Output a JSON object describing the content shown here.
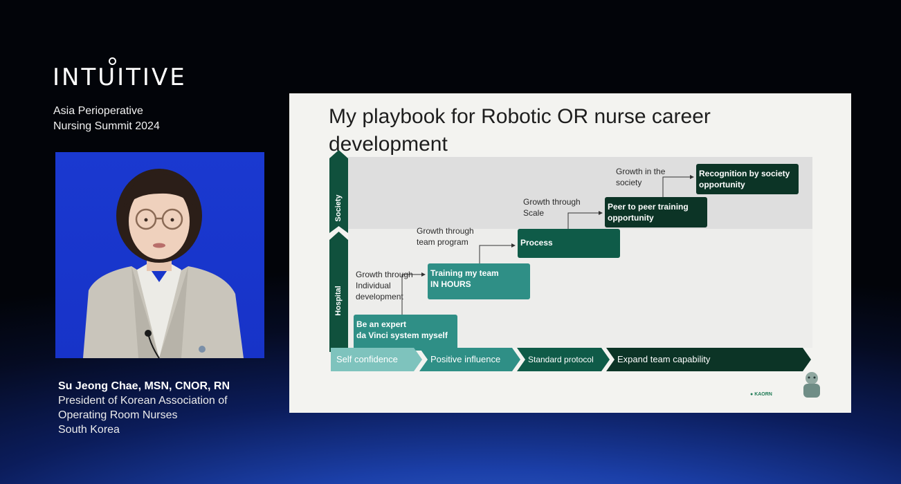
{
  "brand": {
    "logo_text": "INTUITIVE",
    "event_line1": "Asia Perioperative",
    "event_line2": "Nursing Summit 2024"
  },
  "speaker": {
    "name": "Su Jeong Chae, MSN, CNOR, RN",
    "title_line1": "President of Korean Association of",
    "title_line2": "Operating Room Nurses",
    "country": "South Korea"
  },
  "slide": {
    "title_line1": "My playbook for Robotic OR nurse career",
    "title_line2": "development",
    "vertical_labels": {
      "society": "Society",
      "hospital": "Hospital"
    },
    "steps": [
      {
        "box": "Be an expert\nda Vinci system myself",
        "connector_label": ""
      },
      {
        "box": "Training my team\nIN HOURS",
        "connector_label": "Growth through\nIndividual\ndevelopment"
      },
      {
        "box": "Process",
        "connector_label": "Growth through\nteam program"
      },
      {
        "box": "Peer to peer training\nopportunity",
        "connector_label": "Growth through\nScale"
      },
      {
        "box": "Recognition by society\nopportunity",
        "connector_label": "Growth in the\nsociety"
      }
    ],
    "timeline": [
      "Self confidence",
      "Positive influence",
      "Standard protocol",
      "Expand team capability"
    ],
    "footer_logo_text": "KAORN"
  },
  "colors": {
    "teal": "#2f8f86",
    "dark_green": "#0f5b48",
    "very_dark_green": "#0c3426",
    "light_teal": "#7ec3bd"
  }
}
